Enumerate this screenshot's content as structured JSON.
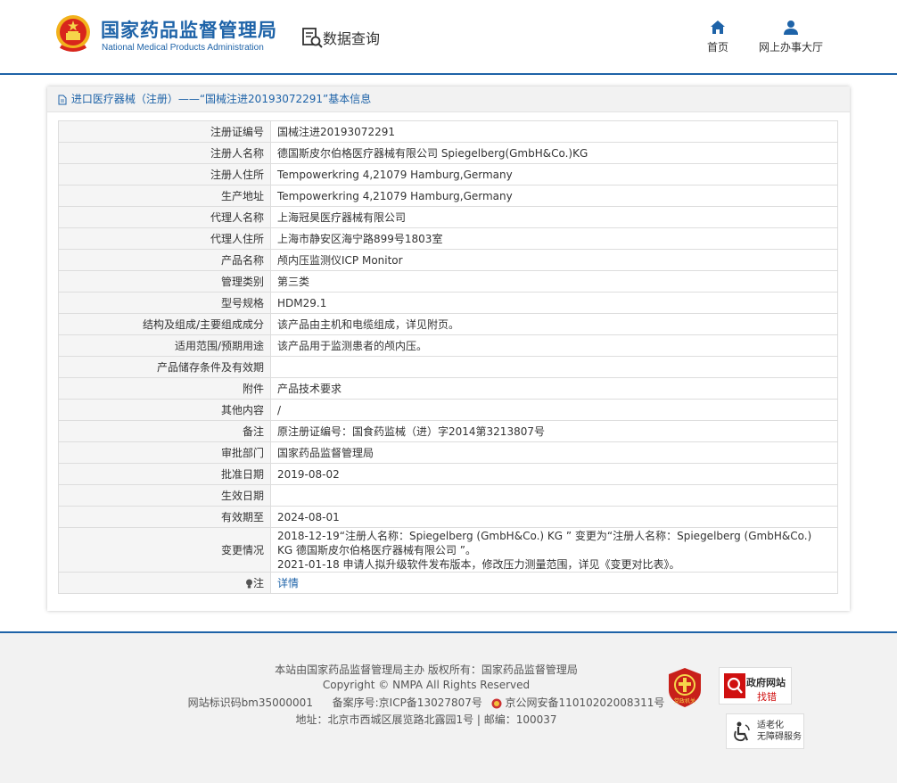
{
  "header": {
    "site_title": "国家药品监督管理局",
    "site_subtitle": "National Medical Products Administration",
    "query_title": "数据查询",
    "nav": [
      {
        "label": "首页",
        "icon": "home-icon"
      },
      {
        "label": "网上办事大厅",
        "icon": "user-icon"
      }
    ],
    "brand_color": "#1e63a8"
  },
  "panel": {
    "heading": "进口医疗器械（注册）——“国械注进20193072291”基本信息",
    "rows": [
      {
        "label": "注册证编号",
        "value": "国械注进20193072291"
      },
      {
        "label": "注册人名称",
        "value": "德国斯皮尔伯格医疗器械有限公司 Spiegelberg(GmbH&Co.)KG"
      },
      {
        "label": "注册人住所",
        "value": "Tempowerkring 4,21079 Hamburg,Germany"
      },
      {
        "label": "生产地址",
        "value": "Tempowerkring 4,21079 Hamburg,Germany"
      },
      {
        "label": "代理人名称",
        "value": "上海冠昊医疗器械有限公司"
      },
      {
        "label": "代理人住所",
        "value": "上海市静安区海宁路899号1803室"
      },
      {
        "label": "产品名称",
        "value": "颅内压监测仪ICP Monitor"
      },
      {
        "label": "管理类别",
        "value": "第三类"
      },
      {
        "label": "型号规格",
        "value": "HDM29.1"
      },
      {
        "label": "结构及组成/主要组成成分",
        "value": "该产品由主机和电缆组成，详见附页。"
      },
      {
        "label": "适用范围/预期用途",
        "value": "该产品用于监测患者的颅内压。"
      },
      {
        "label": "产品储存条件及有效期",
        "value": ""
      },
      {
        "label": "附件",
        "value": "产品技术要求"
      },
      {
        "label": "其他内容",
        "value": "/"
      },
      {
        "label": "备注",
        "value": "原注册证编号：国食药监械（进）字2014第3213807号"
      },
      {
        "label": "审批部门",
        "value": "国家药品监督管理局"
      },
      {
        "label": "批准日期",
        "value": "2019-08-02"
      },
      {
        "label": "生效日期",
        "value": ""
      },
      {
        "label": "有效期至",
        "value": "2024-08-01"
      }
    ],
    "change_label": "变更情况",
    "change_lines": [
      "2018-12-19“注册人名称：Spiegelberg (GmbH&Co.) KG ” 变更为“注册人名称：Spiegelberg (GmbH&Co.)",
      "KG 德国斯皮尔伯格医疗器械有限公司 ”。",
      "2021-01-18 申请人拟升级软件发布版本，修改压力测量范围，详见《变更对比表》。"
    ],
    "note_label": "注",
    "note_link": "详情"
  },
  "footer": {
    "line1": "本站由国家药品监督管理局主办 版权所有：国家药品监督管理局",
    "line2": "Copyright © NMPA All Rights Reserved",
    "line3a": "网站标识码bm35000001",
    "line3b": "备案序号:京ICP备13027807号",
    "line3c": "京公网安备11010202008311号",
    "line4": "地址：北京市西城区展览路北露园1号 | 邮编：100037",
    "badge_gov_1": "政府网站",
    "badge_gov_2": "找错",
    "badge_acc_1": "适老化",
    "badge_acc_2": "无障碍服务",
    "badge_red_text": "党政机关"
  }
}
